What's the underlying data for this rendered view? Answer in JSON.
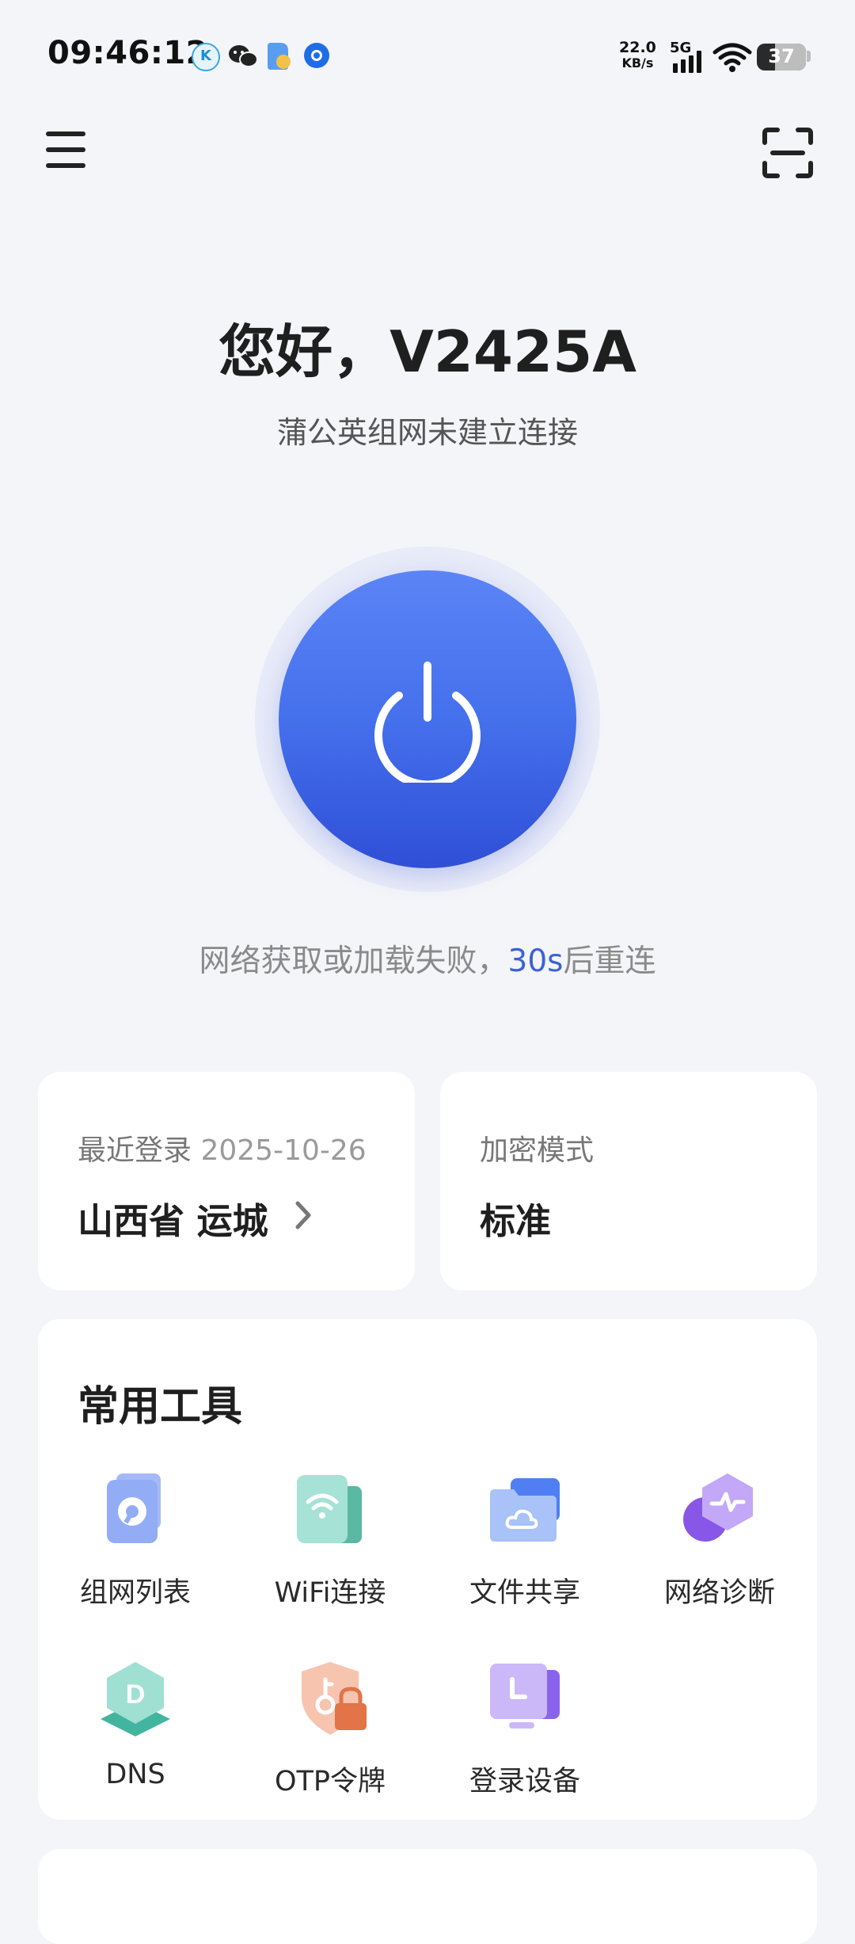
{
  "status_bar": {
    "time": "09:46:12",
    "net_speed_value": "22.0",
    "net_speed_unit": "KB/s",
    "network_type": "5G",
    "battery": "37",
    "battery_level": 0.37,
    "notification_icons": [
      "k-app-icon",
      "wechat-icon",
      "files-app-icon",
      "browser-app-icon"
    ]
  },
  "header": {
    "menu_icon": "menu-icon",
    "scan_icon": "scan-icon"
  },
  "greeting": "您好，V2425A",
  "subtitle": "蒲公英组网未建立连接",
  "power": {
    "icon": "power-icon",
    "status_prefix": "网络获取或加载失败，",
    "countdown": "30s",
    "status_suffix": "后重连"
  },
  "info_cards": {
    "login": {
      "label": "最近登录",
      "date": "2025-10-26",
      "value": "山西省 运城",
      "chevron": "chevron-right-icon"
    },
    "encryption": {
      "label": "加密模式",
      "value": "标准"
    }
  },
  "tools": {
    "title": "常用工具",
    "items": [
      {
        "label": "组网列表",
        "icon": "network-list-icon"
      },
      {
        "label": "WiFi连接",
        "icon": "wifi-icon"
      },
      {
        "label": "文件共享",
        "icon": "cloud-folder-icon"
      },
      {
        "label": "网络诊断",
        "icon": "diagnosis-icon"
      },
      {
        "label": "DNS",
        "icon": "dns-icon"
      },
      {
        "label": "OTP令牌",
        "icon": "otp-shield-icon"
      },
      {
        "label": "登录设备",
        "icon": "login-device-icon"
      }
    ]
  },
  "colors": {
    "accent": "#4570ec",
    "background": "#f4f5f9",
    "countdown": "#3a62d6"
  }
}
